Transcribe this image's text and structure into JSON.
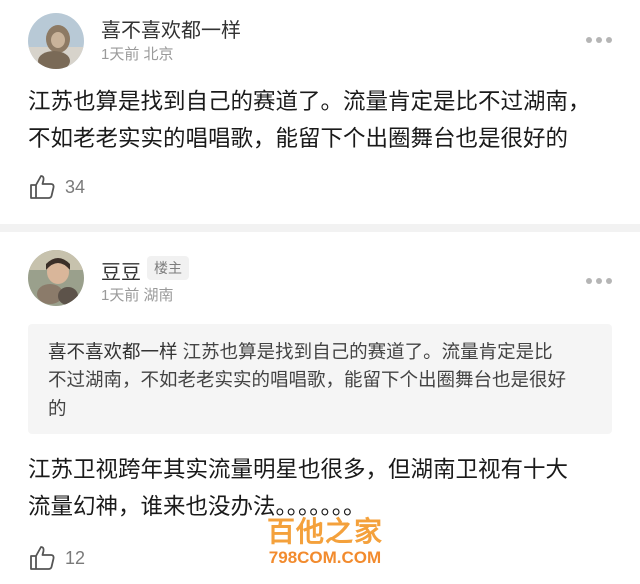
{
  "comments": [
    {
      "username": "喜不喜欢都一样",
      "meta": "1天前 北京",
      "text_lines": [
        "江苏也算是找到自己的赛道了。流量肯定是比不过湖南，",
        "不如老老实实的唱唱歌，能留下个出圈舞台也是很好的"
      ],
      "likes": "34"
    },
    {
      "username": "豆豆",
      "badge": "楼主",
      "meta": "1天前 湖南",
      "quote": {
        "name": "喜不喜欢都一样",
        "line1": "江苏也算是找到自己的赛道了。流量肯定是比",
        "line2": "不过湖南，不如老老实实的唱唱歌，能留下个出圈舞台也是很好",
        "line3": "的"
      },
      "text_lines": [
        "江苏卫视跨年其实流量明星也很多，但湖南卫视有十大",
        "流量幻神，谁来也没办法。。。。。。。"
      ],
      "likes": "12"
    }
  ],
  "watermark": {
    "cn": "百他之家",
    "en": "798COM.COM"
  },
  "icons": {
    "like": "thumbs-up-icon",
    "more": "more-dots-icon"
  }
}
